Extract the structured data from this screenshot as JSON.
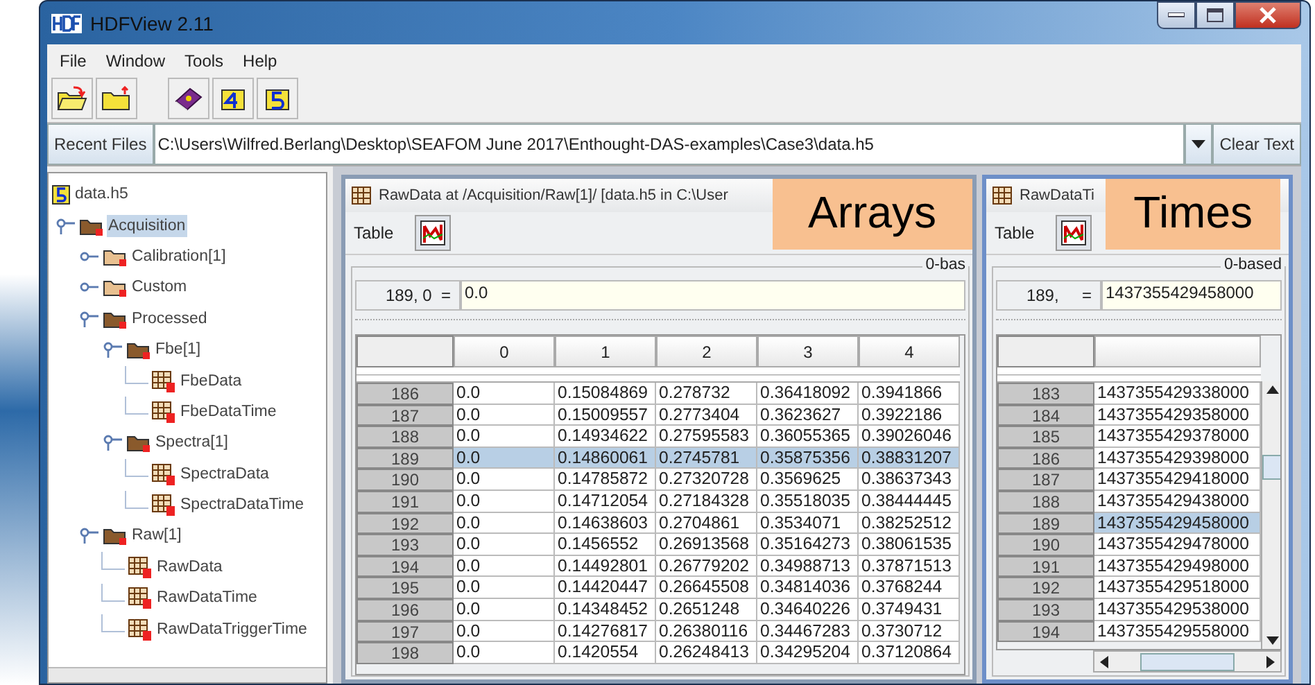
{
  "window": {
    "title": "HDFView 2.11"
  },
  "menu": [
    "File",
    "Window",
    "Tools",
    "Help"
  ],
  "recent_files": {
    "label": "Recent Files",
    "value": "C:\\Users\\Wilfred.Berlang\\Desktop\\SEAFOM June 2017\\Enthought-DAS-examples\\Case3\\data.h5",
    "clear": "Clear Text"
  },
  "tree": {
    "name": "data.h5",
    "kind": "file",
    "children": [
      {
        "name": "Acquisition",
        "kind": "group",
        "expanded": true,
        "selected": true,
        "children": [
          {
            "name": "Calibration[1]",
            "kind": "group",
            "expanded": false,
            "selected": false
          },
          {
            "name": "Custom",
            "kind": "group",
            "expanded": false,
            "selected": false
          },
          {
            "name": "Processed",
            "kind": "group",
            "expanded": true,
            "selected": false,
            "children": [
              {
                "name": "Fbe[1]",
                "kind": "group",
                "expanded": true,
                "selected": false,
                "children": [
                  {
                    "name": "FbeData",
                    "kind": "dataset",
                    "selected": false
                  },
                  {
                    "name": "FbeDataTime",
                    "kind": "dataset",
                    "selected": false
                  }
                ]
              },
              {
                "name": "Spectra[1]",
                "kind": "group",
                "expanded": true,
                "selected": false,
                "children": [
                  {
                    "name": "SpectraData",
                    "kind": "dataset",
                    "selected": false
                  },
                  {
                    "name": "SpectraDataTime",
                    "kind": "dataset",
                    "selected": false
                  }
                ]
              }
            ]
          },
          {
            "name": "Raw[1]",
            "kind": "group",
            "expanded": true,
            "selected": false,
            "children": [
              {
                "name": "RawData",
                "kind": "dataset",
                "selected": false
              },
              {
                "name": "RawDataTime",
                "kind": "dataset",
                "selected": false
              },
              {
                "name": "RawDataTriggerTime",
                "kind": "dataset",
                "selected": false
              }
            ]
          }
        ]
      }
    ]
  },
  "panels": [
    {
      "title": "RawData at /Acquisition/Raw[1]/ [data.h5 in C:\\User",
      "menu": "Table",
      "based": "0-bas",
      "cell_ref": "189, 0  =",
      "cell_value": "0.0",
      "columns": [
        "0",
        "1",
        "2",
        "3",
        "4"
      ],
      "callout": "Arrays",
      "rows": [
        {
          "index": "186",
          "cells": [
            "0.0",
            "0.15084869",
            "0.278732",
            "0.36418092",
            "0.3941866"
          ],
          "selected": false
        },
        {
          "index": "187",
          "cells": [
            "0.0",
            "0.15009557",
            "0.2773404",
            "0.3623627",
            "0.3922186"
          ],
          "selected": false
        },
        {
          "index": "188",
          "cells": [
            "0.0",
            "0.14934622",
            "0.27595583",
            "0.36055365",
            "0.39026046"
          ],
          "selected": false
        },
        {
          "index": "189",
          "cells": [
            "0.0",
            "0.14860061",
            "0.2745781",
            "0.35875356",
            "0.38831207"
          ],
          "selected": true
        },
        {
          "index": "190",
          "cells": [
            "0.0",
            "0.14785872",
            "0.27320728",
            "0.3569625",
            "0.38637343"
          ],
          "selected": false
        },
        {
          "index": "191",
          "cells": [
            "0.0",
            "0.14712054",
            "0.27184328",
            "0.35518035",
            "0.38444445"
          ],
          "selected": false
        },
        {
          "index": "192",
          "cells": [
            "0.0",
            "0.14638603",
            "0.2704861",
            "0.3534071",
            "0.38252512"
          ],
          "selected": false
        },
        {
          "index": "193",
          "cells": [
            "0.0",
            "0.1456552",
            "0.26913568",
            "0.35164273",
            "0.38061535"
          ],
          "selected": false
        },
        {
          "index": "194",
          "cells": [
            "0.0",
            "0.14492801",
            "0.26779202",
            "0.34988713",
            "0.37871513"
          ],
          "selected": false
        },
        {
          "index": "195",
          "cells": [
            "0.0",
            "0.14420447",
            "0.26645508",
            "0.34814036",
            "0.3768244"
          ],
          "selected": false
        },
        {
          "index": "196",
          "cells": [
            "0.0",
            "0.14348452",
            "0.2651248",
            "0.34640226",
            "0.3749431"
          ],
          "selected": false
        },
        {
          "index": "197",
          "cells": [
            "0.0",
            "0.14276817",
            "0.26380116",
            "0.34467283",
            "0.3730712"
          ],
          "selected": false
        },
        {
          "index": "198",
          "cells": [
            "0.0",
            "0.1420554",
            "0.26248413",
            "0.34295204",
            "0.37120864"
          ],
          "selected": false
        }
      ]
    },
    {
      "title": "RawDataTi",
      "menu": "Table",
      "based": "0-based",
      "cell_ref": "189,     =",
      "cell_value": "1437355429458000",
      "callout": "Times",
      "rows": [
        {
          "index": "183",
          "cells": [
            "1437355429338000"
          ],
          "selected": false
        },
        {
          "index": "184",
          "cells": [
            "1437355429358000"
          ],
          "selected": false
        },
        {
          "index": "185",
          "cells": [
            "1437355429378000"
          ],
          "selected": false
        },
        {
          "index": "186",
          "cells": [
            "1437355429398000"
          ],
          "selected": false
        },
        {
          "index": "187",
          "cells": [
            "1437355429418000"
          ],
          "selected": false
        },
        {
          "index": "188",
          "cells": [
            "1437355429438000"
          ],
          "selected": false
        },
        {
          "index": "189",
          "cells": [
            "1437355429458000"
          ],
          "selected": true
        },
        {
          "index": "190",
          "cells": [
            "1437355429478000"
          ],
          "selected": false
        },
        {
          "index": "191",
          "cells": [
            "1437355429498000"
          ],
          "selected": false
        },
        {
          "index": "192",
          "cells": [
            "1437355429518000"
          ],
          "selected": false
        },
        {
          "index": "193",
          "cells": [
            "1437355429538000"
          ],
          "selected": false
        },
        {
          "index": "194",
          "cells": [
            "1437355429558000"
          ],
          "selected": false
        }
      ]
    }
  ]
}
